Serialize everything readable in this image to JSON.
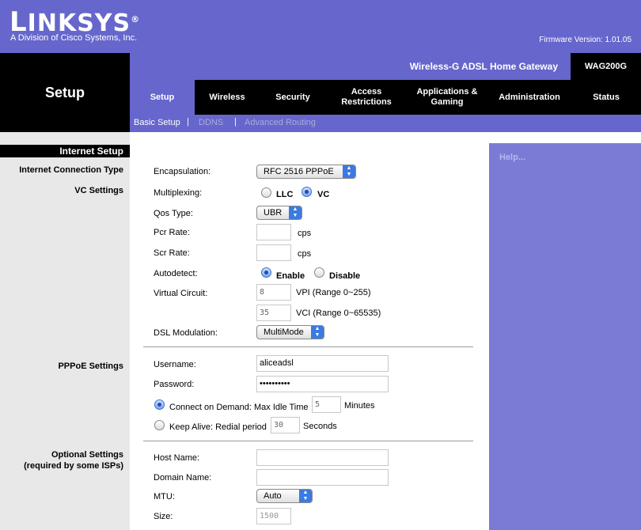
{
  "brand": {
    "logo_big": "L",
    "logo_rest": "INKSYS",
    "logo_mark": "®",
    "division": "A Division of Cisco Systems, Inc.",
    "firmware": "Firmware Version: 1.01.05"
  },
  "product": {
    "name": "Wireless-G ADSL Home Gateway",
    "model": "WAG200G"
  },
  "section_title": "Setup",
  "tabs": [
    {
      "label": "Setup",
      "active": true
    },
    {
      "label": "Wireless"
    },
    {
      "label": "Security"
    },
    {
      "label": "Access Restrictions"
    },
    {
      "label": "Applications & Gaming"
    },
    {
      "label": "Administration"
    },
    {
      "label": "Status"
    }
  ],
  "subtabs": [
    {
      "label": "Basic Setup"
    },
    {
      "label": "DDNS"
    },
    {
      "label": "Advanced Routing"
    }
  ],
  "subtab_sep": "|",
  "left": {
    "heading": "Internet Setup",
    "internet_connection_type": "Internet Connection Type",
    "vc_settings": "VC Settings",
    "pppoe_settings": "PPPoE Settings",
    "optional_settings": "Optional Settings",
    "optional_note": "(required by some ISPs)"
  },
  "help": "Help...",
  "form": {
    "encapsulation_label": "Encapsulation:",
    "encapsulation_value": "RFC 2516 PPPoE",
    "multiplexing_label": "Multiplexing:",
    "llc": "LLC",
    "vc": "VC",
    "qos_label": "Qos Type:",
    "qos_value": "UBR",
    "pcr_label": "Pcr Rate:",
    "pcr_value": "",
    "scr_label": "Scr Rate:",
    "scr_value": "",
    "cps": "cps",
    "autodetect_label": "Autodetect:",
    "enable": "Enable",
    "disable": "Disable",
    "virtual_circuit_label": "Virtual Circuit:",
    "vpi_value": "8",
    "vpi_text": "VPI (Range 0~255)",
    "vci_value": "35",
    "vci_text": "VCI (Range 0~65535)",
    "dsl_label": "DSL Modulation:",
    "dsl_value": "MultiMode",
    "username_label": "Username:",
    "username_value": "aliceadsl",
    "password_label": "Password:",
    "password_value": "••••••••••",
    "connect_on_demand": "Connect on Demand: Max Idle Time",
    "idle_value": "5",
    "minutes": "Minutes",
    "keep_alive": "Keep Alive: Redial period",
    "redial_value": "30",
    "seconds": "Seconds",
    "host_label": "Host Name:",
    "host_value": "",
    "domain_label": "Domain Name:",
    "domain_value": "",
    "mtu_label": "MTU:",
    "mtu_value": "Auto",
    "size_label": "Size:",
    "size_value": "1500"
  }
}
